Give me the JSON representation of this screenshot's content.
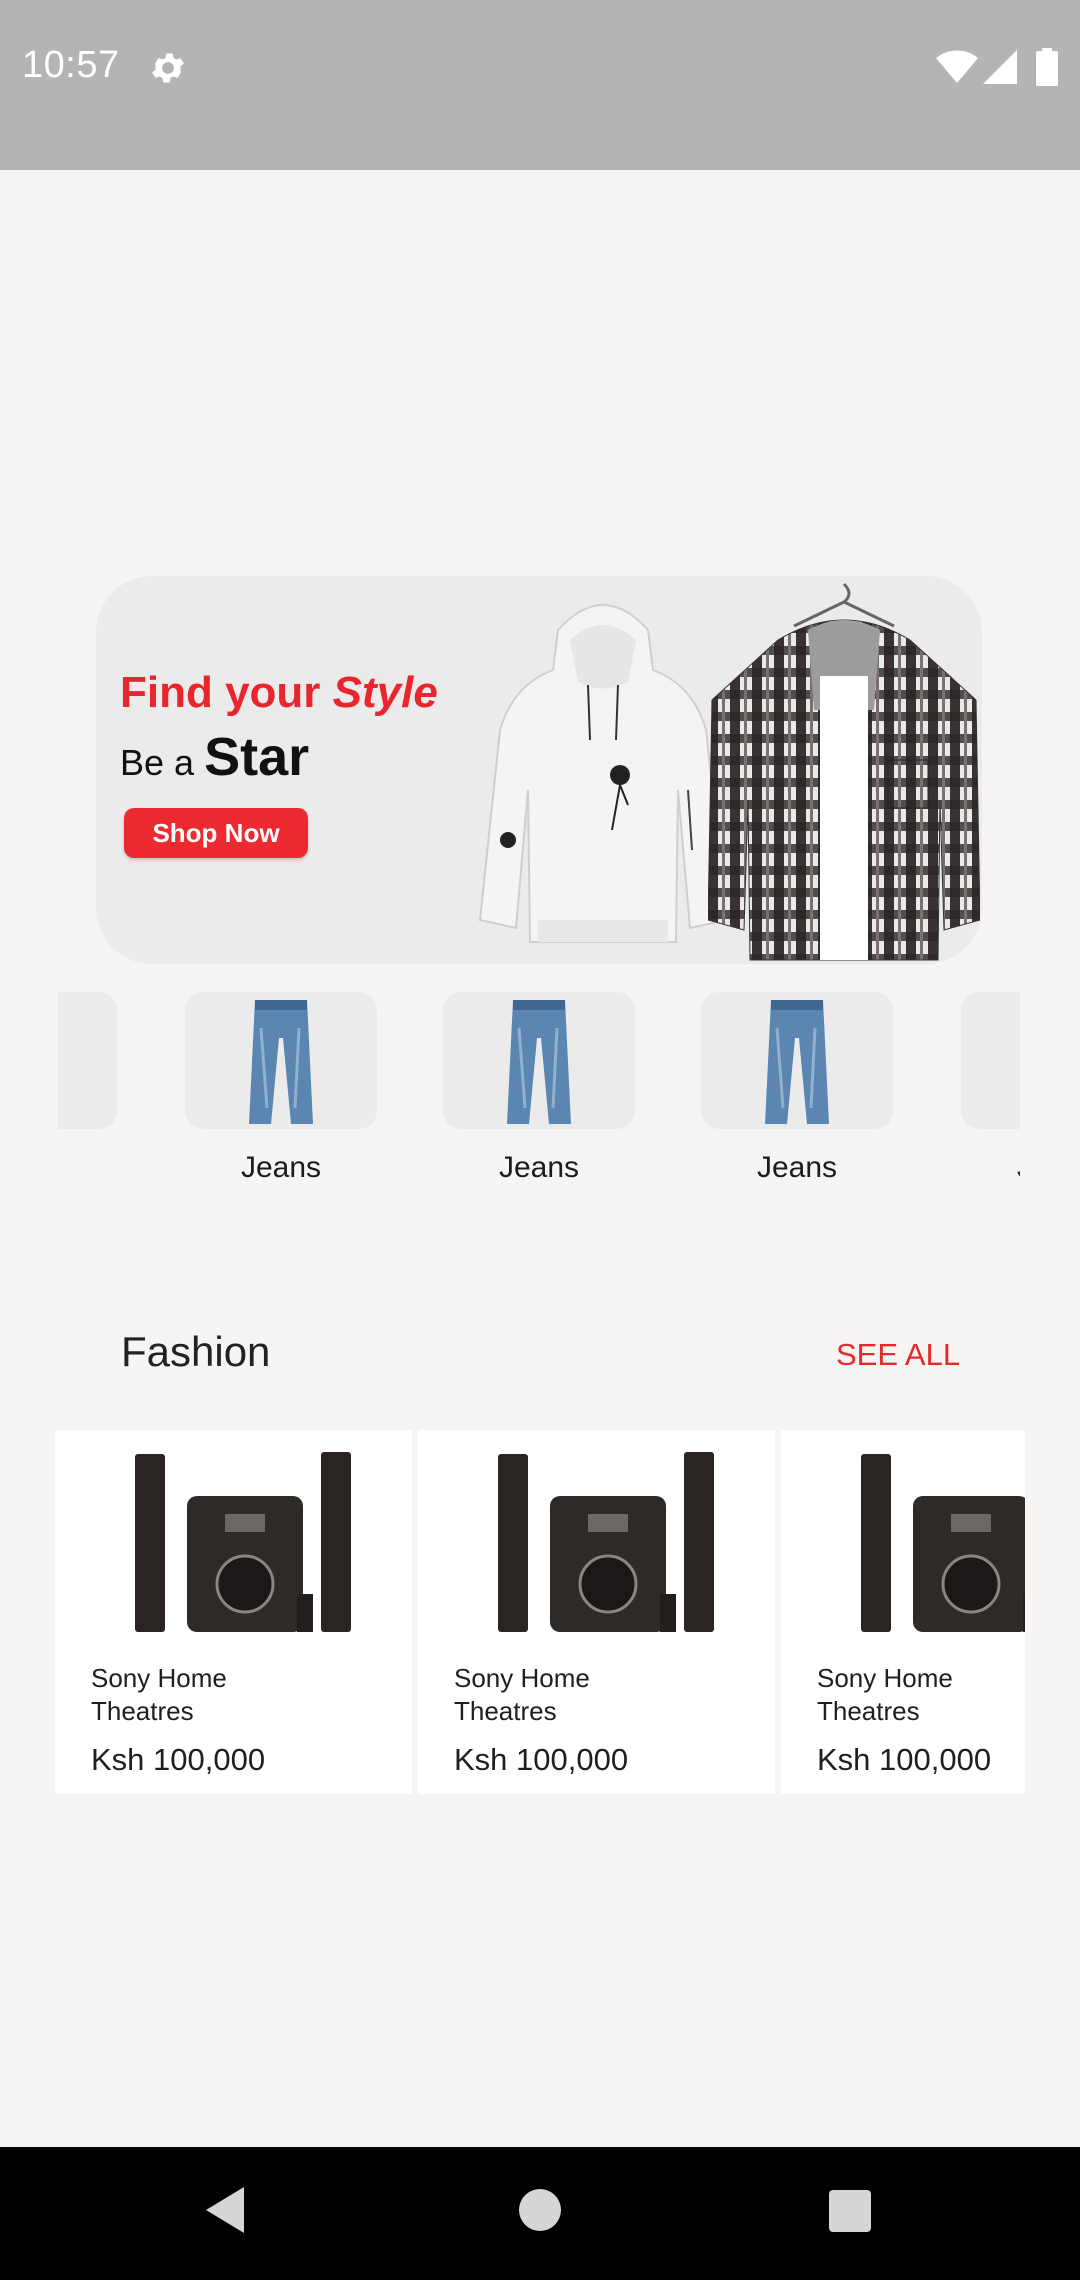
{
  "status_bar": {
    "time": "10:57",
    "icons": [
      "gear-icon",
      "wifi-icon",
      "cell-signal-icon",
      "battery-icon"
    ]
  },
  "banner": {
    "headline_prefix": "Find your ",
    "headline_emphasis": "Style",
    "sub_prefix": "Be a ",
    "sub_emphasis": "Star",
    "button_label": "Shop Now",
    "accent_color": "#e9252e"
  },
  "categories": [
    {
      "label": ""
    },
    {
      "label": "Jeans"
    },
    {
      "label": "Jeans"
    },
    {
      "label": "Jeans"
    },
    {
      "label": "Jeans"
    }
  ],
  "section": {
    "title": "Fashion",
    "see_all": "SEE ALL"
  },
  "products": [
    {
      "name": "Sony Home Theatres",
      "price": "Ksh 100,000"
    },
    {
      "name": "Sony Home Theatres",
      "price": "Ksh 100,000"
    },
    {
      "name": "Sony Home Theatres",
      "price": "Ksh 100,000"
    }
  ],
  "nav_bar": {
    "icons": [
      "back-icon",
      "home-icon",
      "recents-icon"
    ]
  }
}
